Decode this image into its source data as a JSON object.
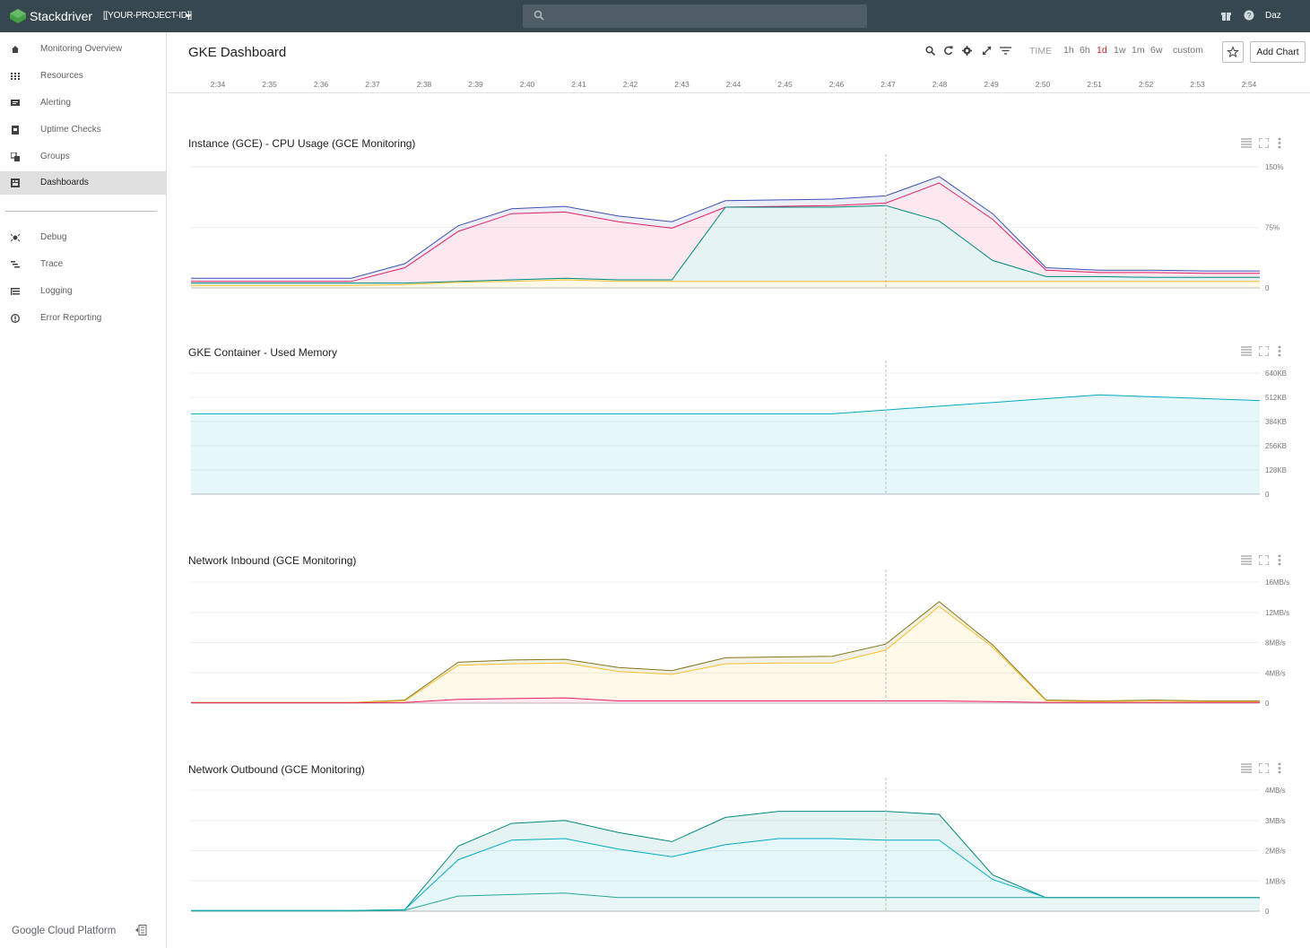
{
  "topbar": {
    "app_name": "Stackdriver",
    "project": "[[YOUR-PROJECT-ID]]",
    "search_placeholder": "",
    "user": "Daz"
  },
  "sidebar": {
    "items": [
      {
        "label": "Monitoring Overview",
        "icon": "home-icon"
      },
      {
        "label": "Resources",
        "icon": "grid-icon"
      },
      {
        "label": "Alerting",
        "icon": "alert-icon"
      },
      {
        "label": "Uptime Checks",
        "icon": "uptime-icon"
      },
      {
        "label": "Groups",
        "icon": "groups-icon"
      },
      {
        "label": "Dashboards",
        "icon": "dashboard-icon",
        "active": true
      }
    ],
    "items2": [
      {
        "label": "Debug",
        "icon": "debug-icon"
      },
      {
        "label": "Trace",
        "icon": "trace-icon"
      },
      {
        "label": "Logging",
        "icon": "logging-icon"
      },
      {
        "label": "Error Reporting",
        "icon": "error-reporting-icon"
      }
    ],
    "footer": "Google Cloud Platform"
  },
  "header": {
    "title": "GKE Dashboard",
    "time_label": "TIME",
    "ranges": [
      "1h",
      "6h",
      "1d",
      "1w",
      "1m",
      "6w",
      "custom"
    ],
    "selected_range": "1d",
    "add_chart": "Add Chart"
  },
  "timeline": {
    "ticks": [
      "2:34",
      "2:35",
      "2:36",
      "2:37",
      "2:38",
      "2:39",
      "2:40",
      "2:41",
      "2:42",
      "2:43",
      "2:44",
      "2:45",
      "2:46",
      "2:47",
      "2:48",
      "2:49",
      "2:50",
      "2:51",
      "2:52",
      "2:53",
      "2:54"
    ]
  },
  "colors": {
    "topbar": "#37474f",
    "selected_range": "#c62828"
  },
  "chart_data": [
    {
      "type": "area",
      "title": "Instance (GCE) - CPU Usage (GCE Monitoring)",
      "ytick_labels": [
        "150%",
        "75%",
        "0"
      ],
      "ylim": [
        0,
        150
      ],
      "x": [
        "2:34",
        "2:35",
        "2:36",
        "2:37",
        "2:38",
        "2:39",
        "2:40",
        "2:41",
        "2:42",
        "2:43",
        "2:44",
        "2:45",
        "2:46",
        "2:47",
        "2:48",
        "2:49",
        "2:50",
        "2:51",
        "2:52",
        "2:53",
        "2:54"
      ],
      "series": [
        {
          "color": "#3f51b5",
          "values": [
            12,
            12,
            12,
            12,
            30,
            77,
            98,
            101,
            89,
            82,
            108,
            109,
            110,
            114,
            138,
            92,
            25,
            22,
            22,
            21,
            21
          ]
        },
        {
          "color": "#e91e63",
          "values": [
            8,
            8,
            8,
            8,
            25,
            70,
            92,
            94,
            82,
            74,
            100,
            101,
            102,
            105,
            130,
            85,
            22,
            19,
            19,
            18,
            18
          ]
        },
        {
          "color": "#00897b",
          "values": [
            6,
            6,
            6,
            6,
            6,
            8,
            10,
            12,
            10,
            10,
            100,
            100,
            100,
            102,
            83,
            34,
            14,
            14,
            13,
            13,
            13
          ]
        },
        {
          "color": "#fbc02d",
          "values": [
            3,
            3,
            3,
            3,
            4,
            7,
            8,
            10,
            8,
            8,
            8,
            8,
            8,
            8,
            8,
            8,
            8,
            8,
            8,
            8,
            8
          ]
        }
      ],
      "grid": true
    },
    {
      "type": "area",
      "title": "GKE Container - Used Memory",
      "ytick_labels": [
        "640KB",
        "512KB",
        "384KB",
        "256KB",
        "128KB",
        "0"
      ],
      "ylim": [
        0,
        640
      ],
      "x": [
        "2:34",
        "2:35",
        "2:36",
        "2:37",
        "2:38",
        "2:39",
        "2:40",
        "2:41",
        "2:42",
        "2:43",
        "2:44",
        "2:45",
        "2:46",
        "2:47",
        "2:48",
        "2:49",
        "2:50",
        "2:51",
        "2:52",
        "2:53",
        "2:54"
      ],
      "series": [
        {
          "color": "#00acc1",
          "values": [
            425,
            425,
            425,
            425,
            425,
            425,
            425,
            425,
            425,
            425,
            425,
            425,
            425,
            445,
            465,
            485,
            505,
            525,
            515,
            505,
            495
          ]
        }
      ],
      "grid": true
    },
    {
      "type": "area",
      "title": "Network Inbound (GCE Monitoring)",
      "ytick_labels": [
        "16MB/s",
        "12MB/s",
        "8MB/s",
        "4MB/s",
        "0"
      ],
      "ylim": [
        0,
        16
      ],
      "x": [
        "2:34",
        "2:35",
        "2:36",
        "2:37",
        "2:38",
        "2:39",
        "2:40",
        "2:41",
        "2:42",
        "2:43",
        "2:44",
        "2:45",
        "2:46",
        "2:47",
        "2:48",
        "2:49",
        "2:50",
        "2:51",
        "2:52",
        "2:53",
        "2:54"
      ],
      "series": [
        {
          "color": "#827717",
          "values": [
            0.1,
            0.1,
            0.1,
            0.1,
            0.4,
            5.4,
            5.7,
            5.8,
            4.7,
            4.3,
            6.0,
            6.1,
            6.2,
            7.8,
            13.4,
            7.7,
            0.4,
            0.3,
            0.4,
            0.3,
            0.3
          ]
        },
        {
          "color": "#fbc02d",
          "values": [
            0.1,
            0.1,
            0.1,
            0.1,
            0.3,
            5.0,
            5.2,
            5.3,
            4.2,
            3.8,
            5.2,
            5.3,
            5.3,
            7.0,
            12.8,
            7.4,
            0.3,
            0.2,
            0.3,
            0.2,
            0.2
          ]
        },
        {
          "color": "#e91e63",
          "values": [
            0.05,
            0.05,
            0.05,
            0.05,
            0.1,
            0.5,
            0.6,
            0.7,
            0.3,
            0.3,
            0.3,
            0.3,
            0.3,
            0.3,
            0.3,
            0.2,
            0.1,
            0.1,
            0.1,
            0.1,
            0.1
          ]
        }
      ],
      "grid": true
    },
    {
      "type": "area",
      "title": "Network Outbound (GCE Monitoring)",
      "ytick_labels": [
        "4MB/s",
        "3MB/s",
        "2MB/s",
        "1MB/s",
        "0"
      ],
      "ylim": [
        0,
        4
      ],
      "x": [
        "2:34",
        "2:35",
        "2:36",
        "2:37",
        "2:38",
        "2:39",
        "2:40",
        "2:41",
        "2:42",
        "2:43",
        "2:44",
        "2:45",
        "2:46",
        "2:47",
        "2:48",
        "2:49",
        "2:50",
        "2:51",
        "2:52",
        "2:53",
        "2:54"
      ],
      "series": [
        {
          "color": "#00897b",
          "values": [
            0.02,
            0.02,
            0.02,
            0.02,
            0.05,
            2.15,
            2.9,
            3.0,
            2.6,
            2.3,
            3.1,
            3.3,
            3.3,
            3.3,
            3.2,
            1.2,
            0.45,
            0.45,
            0.45,
            0.45,
            0.45
          ]
        },
        {
          "color": "#00acc1",
          "values": [
            0.02,
            0.02,
            0.02,
            0.02,
            0.05,
            1.7,
            2.35,
            2.4,
            2.05,
            1.8,
            2.2,
            2.4,
            2.4,
            2.35,
            2.35,
            1.05,
            0.45,
            0.45,
            0.45,
            0.45,
            0.45
          ]
        },
        {
          "color": "#26a69a",
          "values": [
            0.01,
            0.01,
            0.01,
            0.01,
            0.03,
            0.5,
            0.55,
            0.6,
            0.45,
            0.45,
            0.45,
            0.45,
            0.45,
            0.45,
            0.45,
            0.45,
            0.45,
            0.45,
            0.45,
            0.45,
            0.45
          ]
        }
      ],
      "grid": true
    }
  ]
}
